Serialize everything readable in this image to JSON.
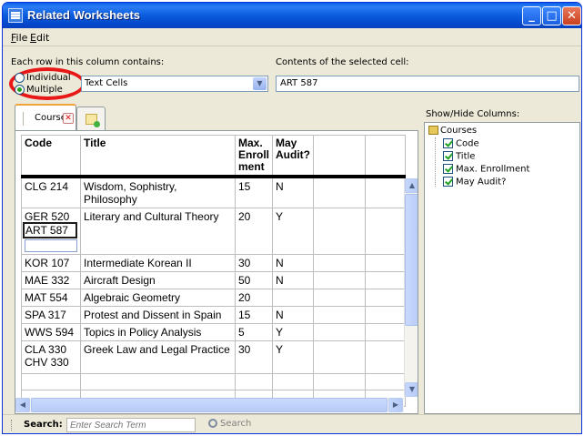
{
  "window": {
    "title": "Related Worksheets"
  },
  "menu": [
    {
      "label": "File",
      "mnemonic": "F",
      "rest": "ile"
    },
    {
      "label": "Edit",
      "mnemonic": "E",
      "rest": "dit"
    }
  ],
  "column_mode": {
    "label": "Each row in this column contains:",
    "options": [
      "Individual",
      "Multiple"
    ],
    "selected": "Multiple",
    "content_type": "Text Cells"
  },
  "selected_cell": {
    "label": "Contents of the selected cell:",
    "value": "ART 587"
  },
  "tabs": [
    {
      "label": "Courses",
      "close": "✕"
    }
  ],
  "grid": {
    "headers": [
      "Code",
      "Title",
      "Max. Enroll ment",
      "May Audit?",
      "",
      ""
    ],
    "rows": [
      {
        "code": [
          "CLG 214"
        ],
        "title": "Wisdom, Sophistry, Philosophy",
        "max": "15",
        "audit": "N"
      },
      {
        "code": [
          "GER 520",
          "ART 587"
        ],
        "title": "Literary and Cultural Theory",
        "max": "20",
        "audit": "Y"
      },
      {
        "code": [
          "KOR 107"
        ],
        "title": "Intermediate Korean II",
        "max": "30",
        "audit": "N"
      },
      {
        "code": [
          "MAE 332"
        ],
        "title": "Aircraft Design",
        "max": "50",
        "audit": "N"
      },
      {
        "code": [
          "MAT 554"
        ],
        "title": "Algebraic Geometry",
        "max": "20",
        "audit": ""
      },
      {
        "code": [
          "SPA 317"
        ],
        "title": "Protest and Dissent in Spain",
        "max": "15",
        "audit": "N"
      },
      {
        "code": [
          "WWS 594"
        ],
        "title": "Topics in Policy Analysis",
        "max": "5",
        "audit": "Y"
      },
      {
        "code": [
          "CLA 330",
          "CHV 330"
        ],
        "title": "Greek Law and Legal Practice",
        "max": "30",
        "audit": "Y"
      }
    ],
    "scroll_up": "▲",
    "scroll_down": "▼",
    "scroll_left": "◀",
    "scroll_right": "▶"
  },
  "columns_panel": {
    "label": "Show/Hide Columns:",
    "root": "Courses",
    "items": [
      "Code",
      "Title",
      "Max. Enrollment",
      "May Audit?"
    ]
  },
  "search": {
    "label": "Search:",
    "placeholder": "Enter Search Term",
    "button": "Search"
  },
  "colors": {
    "titlebar": "#0a5fe8",
    "highlight": "#e81818",
    "tab_accent": "#f0a33a",
    "check": "#21a121"
  }
}
